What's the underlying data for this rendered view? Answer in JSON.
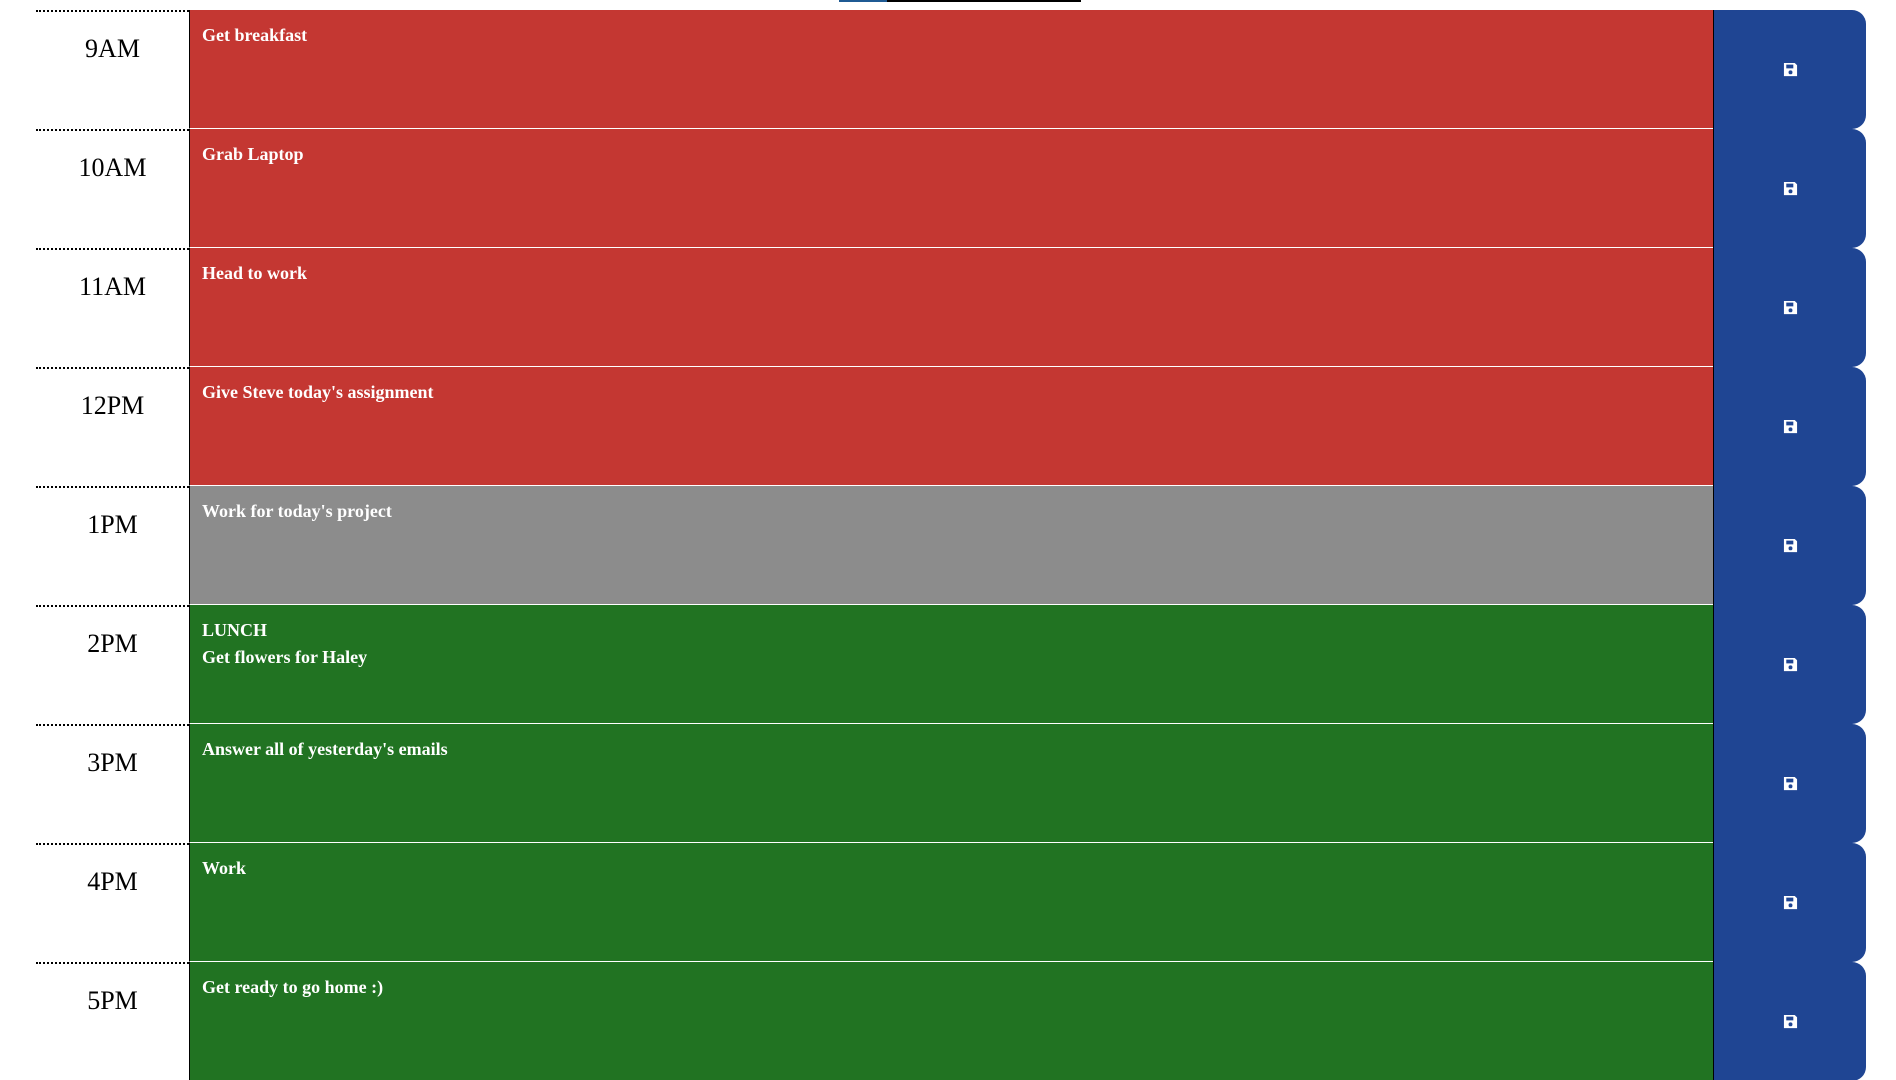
{
  "colors": {
    "past": "#c43732",
    "present": "#8c8c8c",
    "future": "#217322",
    "save_button": "#1f4593"
  },
  "rows": [
    {
      "hour": "9AM",
      "text": "Get breakfast",
      "status": "past",
      "save_icon": "save-icon"
    },
    {
      "hour": "10AM",
      "text": "Grab Laptop",
      "status": "past",
      "save_icon": "save-icon"
    },
    {
      "hour": "11AM",
      "text": "Head to work",
      "status": "past",
      "save_icon": "save-icon"
    },
    {
      "hour": "12PM",
      "text": "Give Steve today's assignment",
      "status": "past",
      "save_icon": "save-icon"
    },
    {
      "hour": "1PM",
      "text": "Work for today's project",
      "status": "present",
      "save_icon": "save-icon"
    },
    {
      "hour": "2PM",
      "text": "LUNCH\nGet flowers for Haley",
      "status": "future",
      "save_icon": "save-icon"
    },
    {
      "hour": "3PM",
      "text": "Answer all of yesterday's emails",
      "status": "future",
      "save_icon": "save-icon"
    },
    {
      "hour": "4PM",
      "text": "Work",
      "status": "future",
      "save_icon": "save-icon"
    },
    {
      "hour": "5PM",
      "text": "Get ready to go home :)",
      "status": "future",
      "save_icon": "save-icon"
    }
  ]
}
